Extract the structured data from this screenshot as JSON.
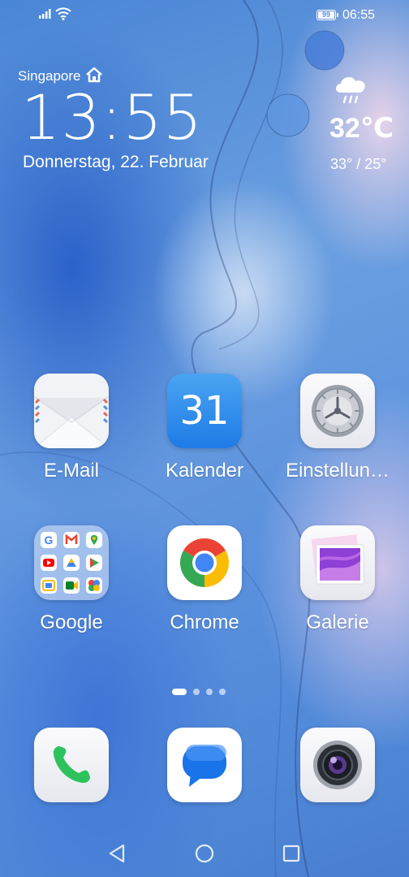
{
  "status_bar": {
    "battery": "99",
    "time": "06:55"
  },
  "clock_widget": {
    "city": "Singapore",
    "time": "13:55",
    "date": "Donnerstag, 22. Februar",
    "temperature": "32℃",
    "range": "33° / 25°"
  },
  "apps": {
    "email": "E-Mail",
    "calendar": "Kalender",
    "calendar_day": "31",
    "settings": "Einstellun…",
    "google": "Google",
    "chrome": "Chrome",
    "gallery": "Galerie"
  },
  "page_indicator": {
    "pages": 4,
    "current": 1
  }
}
